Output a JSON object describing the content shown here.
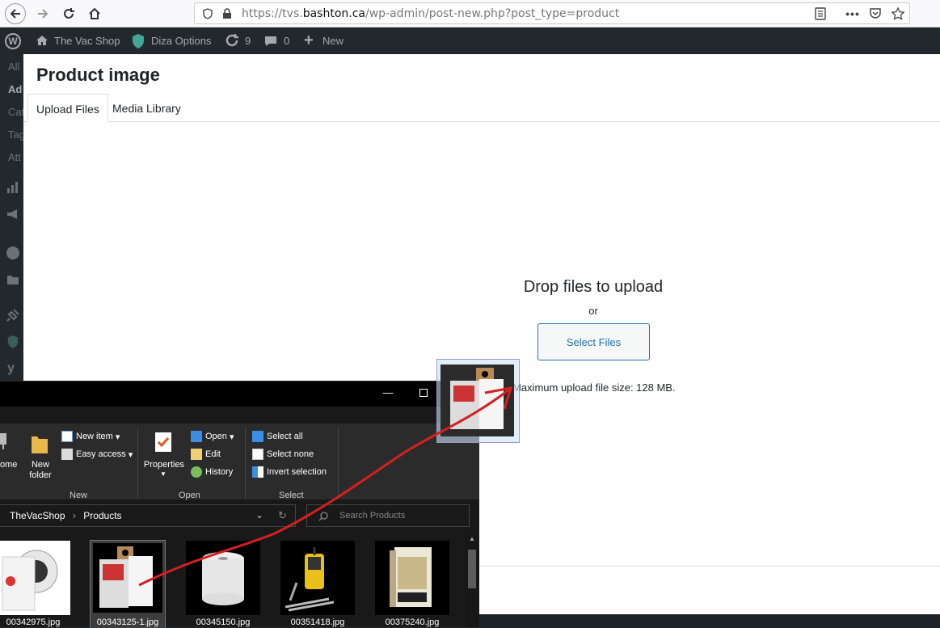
{
  "browser": {
    "url_prefix": "https://tvs.",
    "url_host": "bashton.ca",
    "url_path": "/wp-admin/post-new.php?post_type=product"
  },
  "adminbar": {
    "site_name": "The Vac Shop",
    "options_label": "Diza Options",
    "updates_count": "9",
    "comments_count": "0",
    "new_label": "New"
  },
  "sidebar": {
    "items": [
      "All",
      "Ad",
      "Cat",
      "Tag",
      "Att"
    ]
  },
  "modal": {
    "title": "Product image",
    "tabs": [
      {
        "label": "Upload Files",
        "active": true
      },
      {
        "label": "Media Library",
        "active": false
      }
    ],
    "drop_title": "Drop files to upload",
    "or_label": "or",
    "select_files_label": "Select Files",
    "max_size_text": "Maximum upload file size: 128 MB."
  },
  "explorer": {
    "ribbon": {
      "home_partial": "ome",
      "new_folder_label": "New\nfolder",
      "new_item_label": "New item",
      "easy_access_label": "Easy access",
      "group_new": "New",
      "properties_label": "Properties",
      "open_label": "Open",
      "edit_label": "Edit",
      "history_label": "History",
      "group_open": "Open",
      "select_all_label": "Select all",
      "select_none_label": "Select none",
      "invert_selection_label": "Invert selection",
      "group_select": "Select"
    },
    "address": {
      "crumb1": "TheVacShop",
      "crumb2": "Products"
    },
    "search_placeholder": "Search Products",
    "files": [
      {
        "name": "00342975.jpg",
        "selected": false
      },
      {
        "name": "00343125-1.jpg",
        "selected": true
      },
      {
        "name": "00345150.jpg",
        "selected": false
      },
      {
        "name": "00351418.jpg",
        "selected": false
      },
      {
        "name": "00375240.jpg",
        "selected": false
      }
    ]
  },
  "colors": {
    "wp_dark": "#23282d",
    "wp_blue": "#2271b1",
    "drag_line": "#d42020"
  }
}
